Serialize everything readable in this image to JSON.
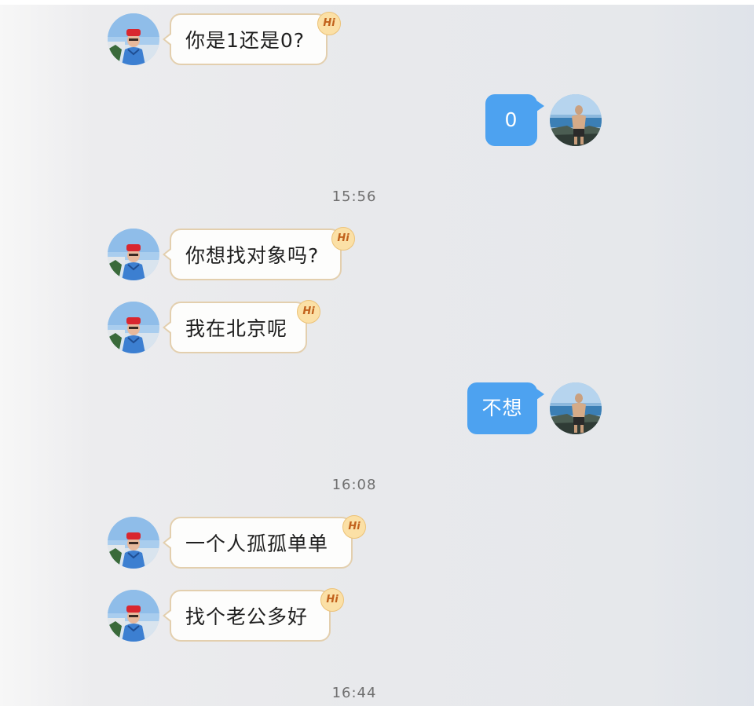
{
  "messages": [
    {
      "side": "in",
      "text": "你是1还是0?",
      "badge": "Hi"
    },
    {
      "side": "out",
      "text": "0"
    },
    {
      "side": "in",
      "text": "你想找对象吗?",
      "badge": "Hi"
    },
    {
      "side": "in",
      "text": "我在北京呢",
      "badge": "Hi"
    },
    {
      "side": "out",
      "text": "不想"
    },
    {
      "side": "in",
      "text": "一个人孤孤单单",
      "badge": "Hi"
    },
    {
      "side": "in",
      "text": "找个老公多好",
      "badge": "Hi"
    }
  ],
  "timestamps": [
    "15:56",
    "16:08",
    "16:44"
  ],
  "colors": {
    "incoming_bubble": "#fdfdfc",
    "incoming_border": "#e3cfae",
    "outgoing_bubble": "#4da2f0",
    "badge": "#fbe0a6",
    "timestamp_text": "#6f6f6f"
  },
  "avatars": {
    "contact": "contact-avatar-red-hat-man",
    "self": "self-avatar-seaside-man"
  }
}
